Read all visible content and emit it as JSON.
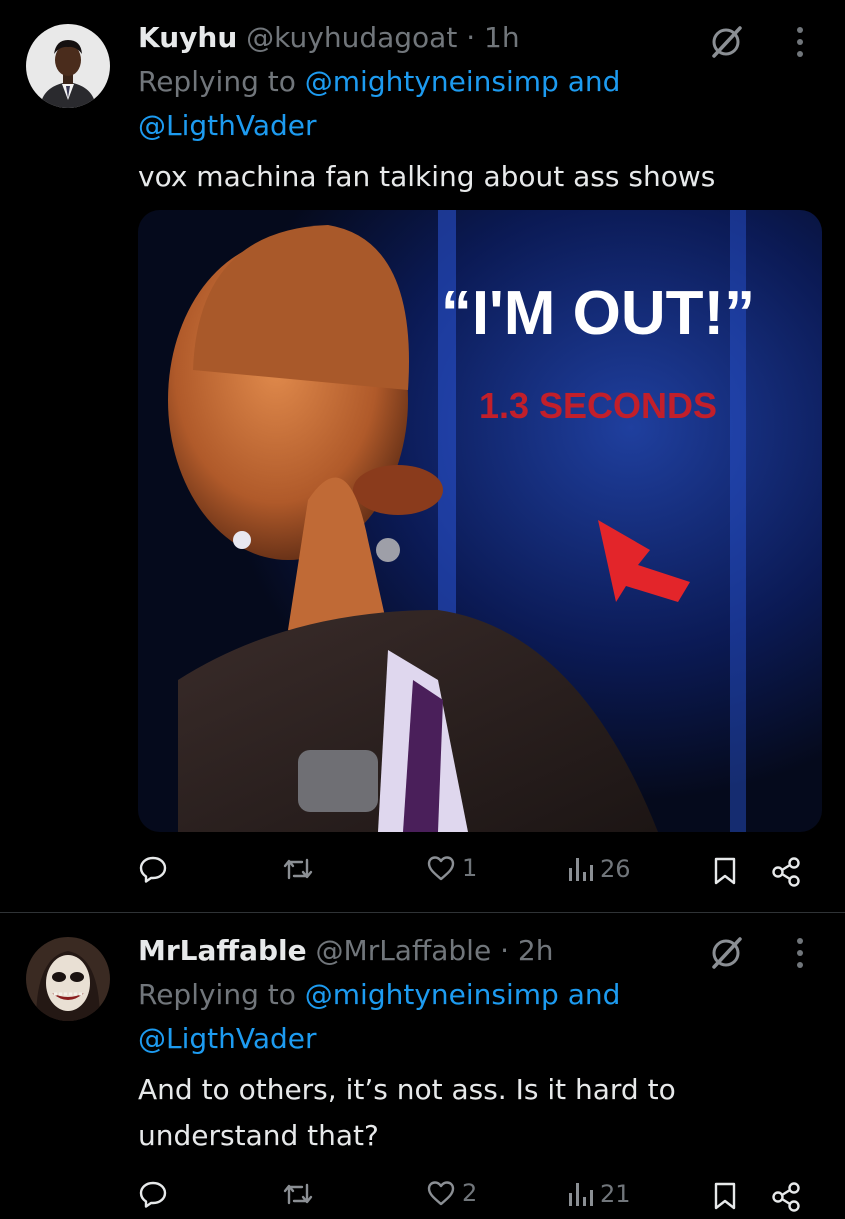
{
  "tweets": [
    {
      "display_name": "Kuyhu",
      "handle": "@kuyhudagoat",
      "separator": "·",
      "time": "1h",
      "replying_prefix": "Replying to",
      "reply_to_1": "@mightyneinsimp",
      "and": "and",
      "reply_to_2": "@LigthVader",
      "text": "vox machina fan talking about ass shows",
      "media": {
        "quote": "“I'M OUT!”",
        "caption": "1.3 SECONDS"
      },
      "stats": {
        "replies": "",
        "reposts": "",
        "likes": "1",
        "views": "26"
      }
    },
    {
      "display_name": "MrLaffable",
      "handle": "@MrLaffable",
      "separator": "·",
      "time": "2h",
      "replying_prefix": "Replying to",
      "reply_to_1": "@mightyneinsimp",
      "and": "and",
      "reply_to_2": "@LigthVader",
      "text_line_1": "And to others, it’s not ass. Is it hard to",
      "text_line_2": "understand that?",
      "stats": {
        "replies": "",
        "reposts": "",
        "likes": "2",
        "views": "21"
      }
    }
  ],
  "icons": [
    "grok-icon",
    "more-icon",
    "reply-icon",
    "repost-icon",
    "like-icon",
    "views-icon",
    "bookmark-icon",
    "share-icon"
  ],
  "colors": {
    "background": "#000000",
    "text": "#e7e9ea",
    "secondary": "#71767b",
    "link": "#1d9bf0",
    "divider": "#2f3336"
  }
}
